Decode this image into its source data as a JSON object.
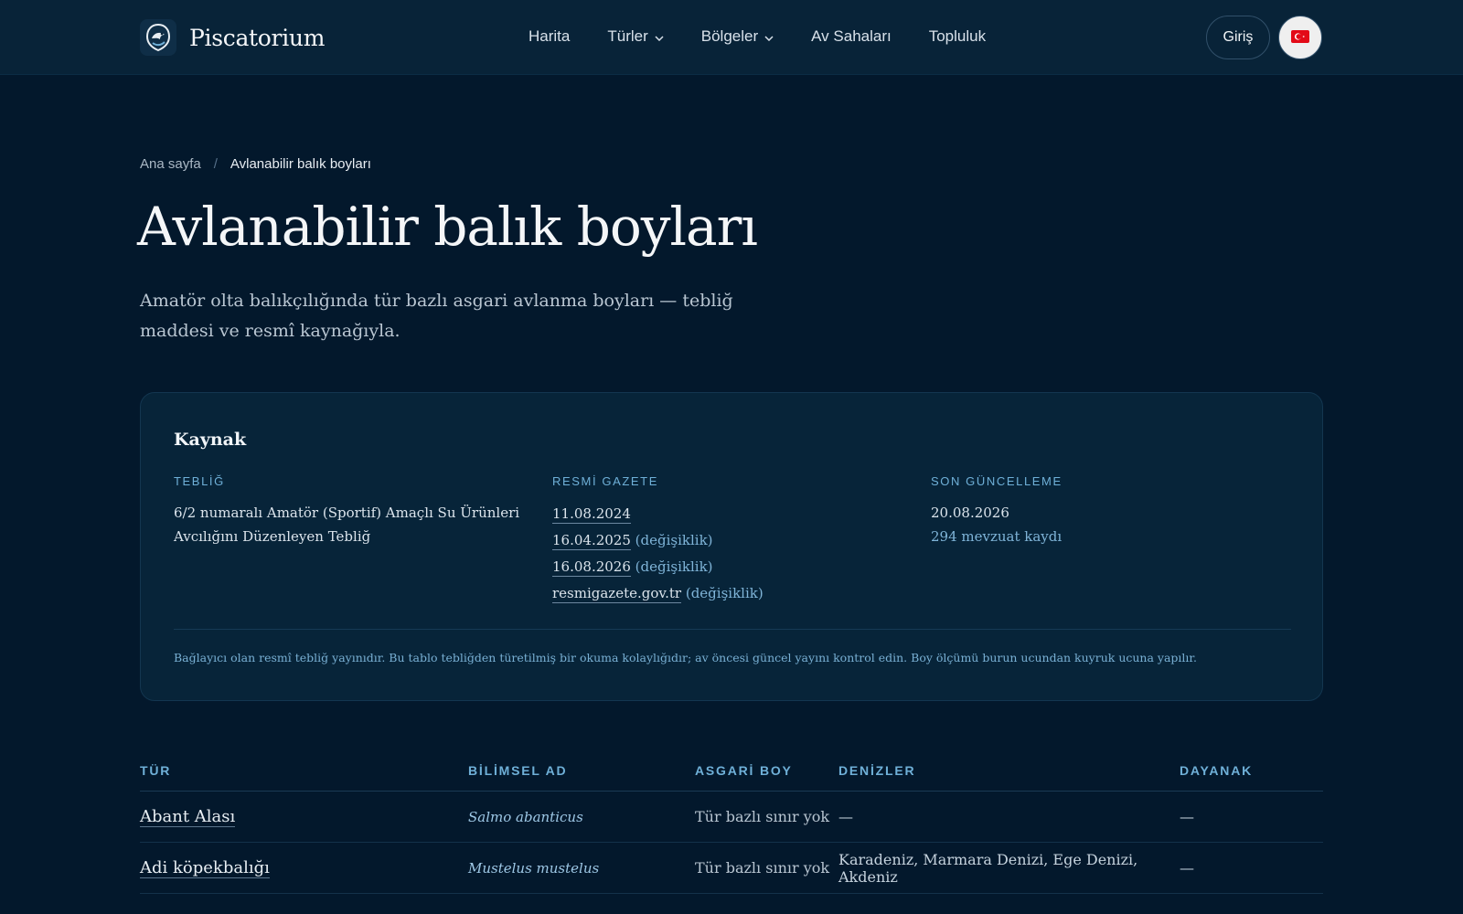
{
  "header": {
    "brand": "Piscatorium",
    "nav": [
      {
        "label": "Harita",
        "dropdown": false
      },
      {
        "label": "Türler",
        "dropdown": true
      },
      {
        "label": "Bölgeler",
        "dropdown": true
      },
      {
        "label": "Av Sahaları",
        "dropdown": false
      },
      {
        "label": "Topluluk",
        "dropdown": false
      }
    ],
    "login_label": "Giriş",
    "language_icon": "turkish-flag-icon"
  },
  "breadcrumb": {
    "home": "Ana sayfa",
    "separator": "/",
    "current": "Avlanabilir balık boyları"
  },
  "page": {
    "title": "Avlanabilir balık boyları",
    "lead": "Amatör olta balıkçılığında tür bazlı asgari avlanma boyları — tebliğ maddesi ve resmî kaynağıyla."
  },
  "source_card": {
    "title": "Kaynak",
    "teblig": {
      "label": "TEBLİĞ",
      "text": "6/2 numaralı Amatör (Sportif) Amaçlı Su Ürünleri Avcılığını Düzenleyen Tebliğ"
    },
    "resmi_gazete": {
      "label": "RESMİ GAZETE",
      "entries": [
        {
          "date": "11.08.2024",
          "note": ""
        },
        {
          "date": "16.04.2025",
          "note": "(değişiklik)"
        },
        {
          "date": "16.08.2026",
          "note": "(değişiklik)"
        },
        {
          "date": "resmigazete.gov.tr",
          "note": "(değişiklik)"
        }
      ]
    },
    "son_guncelleme": {
      "label": "SON GÜNCELLEME",
      "date": "20.08.2026",
      "records": "294 mevzuat kaydı"
    },
    "note": "Bağlayıcı olan resmî tebliğ yayınıdır. Bu tablo tebliğden türetilmiş bir okuma kolaylığıdır; av öncesi güncel yayını kontrol edin. Boy ölçümü burun ucundan kuyruk ucuna yapılır."
  },
  "table": {
    "headers": [
      "TÜR",
      "BİLİMSEL AD",
      "ASGARİ BOY",
      "DENİZLER",
      "DAYANAK"
    ],
    "rows": [
      {
        "name": "Abant Alası",
        "scientific": "Salmo abanticus",
        "min_size": "Tür bazlı sınır yok",
        "seas": "—",
        "basis": "—"
      },
      {
        "name": "Adi köpekbalığı",
        "scientific": "Mustelus mustelus",
        "min_size": "Tür bazlı sınır yok",
        "seas": "Karadeniz, Marmara Denizi, Ege Denizi, Akdeniz",
        "basis": "—"
      }
    ]
  },
  "colors": {
    "background": "#03182c",
    "header": "#082338",
    "card": "#072439",
    "accent": "#6fb0d8"
  }
}
